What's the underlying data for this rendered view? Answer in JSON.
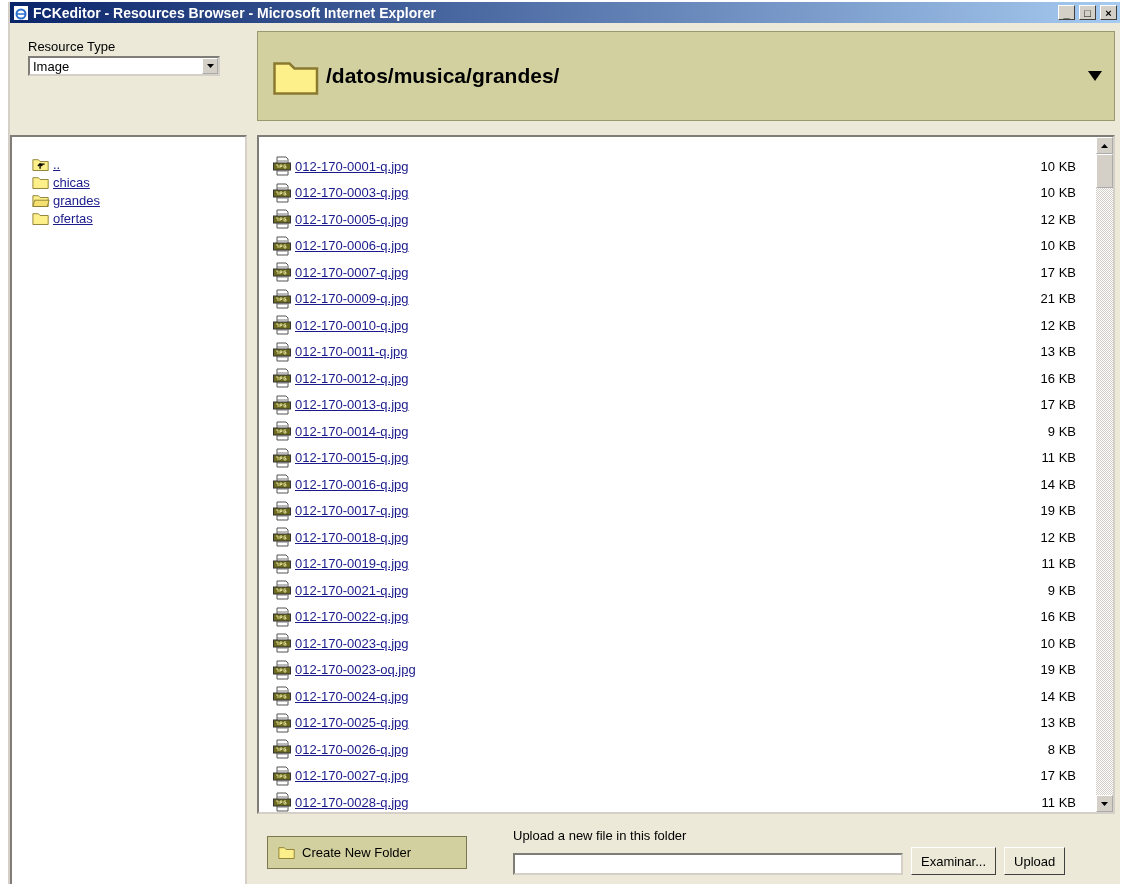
{
  "window": {
    "title": "FCKeditor - Resources Browser - Microsoft Internet Explorer",
    "controls": [
      "_",
      "□",
      "×"
    ]
  },
  "resource_type": {
    "label": "Resource Type",
    "value": "Image"
  },
  "current_path": "/datos/musica/grandes/",
  "folders": [
    {
      "kind": "up",
      "name": "..",
      "open": false
    },
    {
      "kind": "folder",
      "name": "chicas",
      "open": false
    },
    {
      "kind": "folder",
      "name": "grandes",
      "open": true
    },
    {
      "kind": "folder",
      "name": "ofertas",
      "open": false
    }
  ],
  "files": [
    {
      "name": "012-170-0001-q.jpg",
      "size": "10 KB"
    },
    {
      "name": "012-170-0003-q.jpg",
      "size": "10 KB"
    },
    {
      "name": "012-170-0005-q.jpg",
      "size": "12 KB"
    },
    {
      "name": "012-170-0006-q.jpg",
      "size": "10 KB"
    },
    {
      "name": "012-170-0007-q.jpg",
      "size": "17 KB"
    },
    {
      "name": "012-170-0009-q.jpg",
      "size": "21 KB"
    },
    {
      "name": "012-170-0010-q.jpg",
      "size": "12 KB"
    },
    {
      "name": "012-170-0011-q.jpg",
      "size": "13 KB"
    },
    {
      "name": "012-170-0012-q.jpg",
      "size": "16 KB"
    },
    {
      "name": "012-170-0013-q.jpg",
      "size": "17 KB"
    },
    {
      "name": "012-170-0014-q.jpg",
      "size": "9 KB"
    },
    {
      "name": "012-170-0015-q.jpg",
      "size": "11 KB"
    },
    {
      "name": "012-170-0016-q.jpg",
      "size": "14 KB"
    },
    {
      "name": "012-170-0017-q.jpg",
      "size": "19 KB"
    },
    {
      "name": "012-170-0018-q.jpg",
      "size": "12 KB"
    },
    {
      "name": "012-170-0019-q.jpg",
      "size": "11 KB"
    },
    {
      "name": "012-170-0021-q.jpg",
      "size": "9 KB"
    },
    {
      "name": "012-170-0022-q.jpg",
      "size": "16 KB"
    },
    {
      "name": "012-170-0023-q.jpg",
      "size": "10 KB"
    },
    {
      "name": "012-170-0023-oq.jpg",
      "size": "19 KB"
    },
    {
      "name": "012-170-0024-q.jpg",
      "size": "14 KB"
    },
    {
      "name": "012-170-0025-q.jpg",
      "size": "13 KB"
    },
    {
      "name": "012-170-0026-q.jpg",
      "size": "8 KB"
    },
    {
      "name": "012-170-0027-q.jpg",
      "size": "17 KB"
    },
    {
      "name": "012-170-0028-q.jpg",
      "size": "11 KB"
    }
  ],
  "create_folder_button": "Create New Folder",
  "upload": {
    "label": "Upload a new file in this folder",
    "browse_button": "Examinar...",
    "upload_button": "Upload"
  }
}
